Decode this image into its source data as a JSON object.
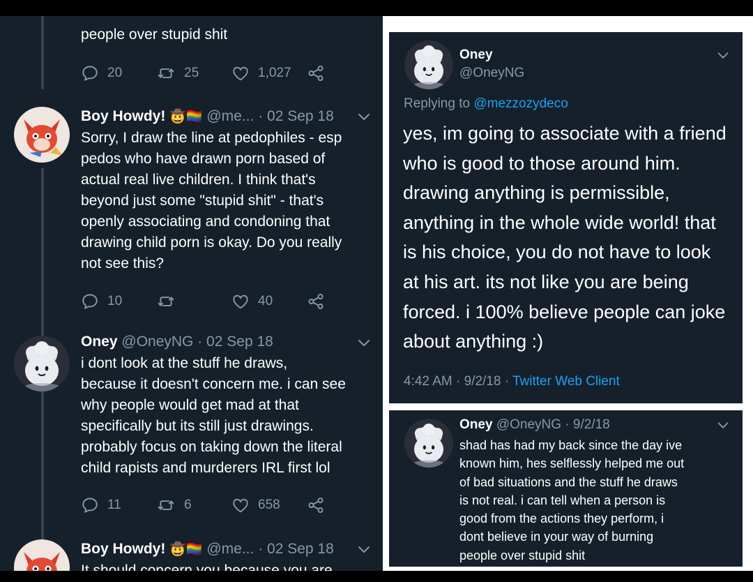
{
  "left": {
    "fragment_text": "people over stupid shit",
    "fragment_actions": {
      "reply": "20",
      "retweet": "25",
      "like": "1,027"
    },
    "tweet1": {
      "name": "Boy Howdy!",
      "emoji": "🤠🏳️‍🌈",
      "handle": "@me...",
      "date": "· 02 Sep 18",
      "lines": [
        "Sorry, I draw the line at pedophiles - esp",
        "pedos who have drawn porn based of",
        "actual real live children. I think that's",
        "beyond just some \"stupid shit\" - that's",
        "openly associating and condoning that",
        "drawing child porn is okay. Do you really",
        "not see this?"
      ],
      "actions": {
        "reply": "10",
        "retweet": "",
        "like": "40"
      }
    },
    "tweet2": {
      "name": "Oney",
      "handle": "@OneyNG",
      "date": "· 02 Sep 18",
      "lines": [
        "i dont look at the stuff he draws,",
        "because it doesn't concern me. i can see",
        "why people would get mad at that",
        "specifically but its still just drawings.",
        "probably focus on taking down the literal",
        "child rapists and murderers IRL first lol"
      ],
      "actions": {
        "reply": "11",
        "retweet": "6",
        "like": "658"
      }
    },
    "tweet3": {
      "name": "Boy Howdy!",
      "emoji": "🤠🏳️‍🌈",
      "handle": "@me...",
      "date": "· 02 Sep 18",
      "partial_line": "It should concern you because you are"
    }
  },
  "right_top": {
    "name": "Oney",
    "handle": "@OneyNG",
    "replying_prefix": "Replying to",
    "replying_to": "@mezzozydeco",
    "lines": [
      "yes, im going to associate with a friend",
      "who is good to those around him.",
      "drawing anything is permissible,",
      "anything in the whole wide world! that",
      "is his choice, you do not have to look",
      "at his art. its not like you are being",
      "forced. i 100% believe people can joke",
      "about anything :)"
    ],
    "timestamp": "4:42 AM · 9/2/18 ·",
    "client": "Twitter Web Client"
  },
  "right_bottom": {
    "name": "Oney",
    "handle": "@OneyNG · 9/2/18",
    "lines": [
      "shad has had my back since the day ive",
      "known him, hes selflessly helped me out",
      "of bad situations and the stuff he draws",
      "is not real. i can tell when a person is",
      "good from the actions they perform, i",
      "dont believe in your way of burning",
      "people over stupid shit"
    ]
  },
  "colors": {
    "bg": "#15202b",
    "text": "#ffffff",
    "muted": "#8899a6",
    "link": "#1da1f2",
    "line": "#38444d"
  },
  "icons": [
    "reply-icon",
    "retweet-icon",
    "like-icon",
    "share-icon",
    "chevron-down-icon"
  ]
}
